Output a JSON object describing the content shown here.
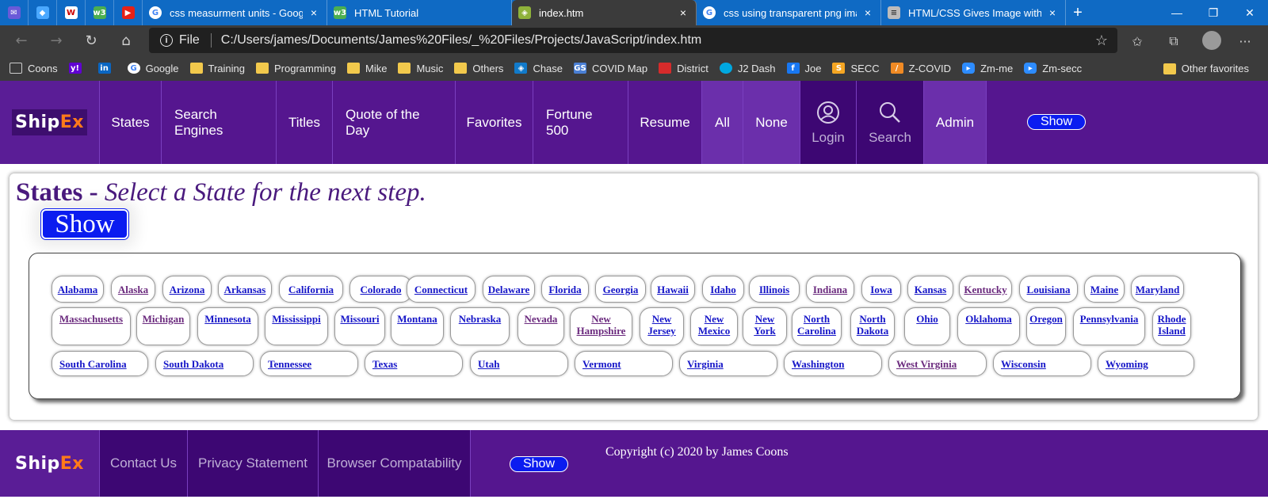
{
  "browser": {
    "tabs": [
      {
        "title": "css measurment units - Google"
      },
      {
        "title": "HTML Tutorial"
      },
      {
        "title": "index.htm"
      },
      {
        "title": "css using transparent png image"
      },
      {
        "title": "HTML/CSS Gives Image with Tra"
      }
    ],
    "close_glyph": "×",
    "new_tab_glyph": "+",
    "address": {
      "scheme_label": "File",
      "url": "C:/Users/james/Documents/James%20Files/_%20Files/Projects/JavaScript/index.htm"
    },
    "bookmarks": [
      {
        "label": "Coons",
        "icon": "page-icon"
      },
      {
        "label": "",
        "icon": "yahoo-icon"
      },
      {
        "label": "",
        "icon": "linkedin-icon"
      },
      {
        "label": "Google",
        "icon": "google-icon"
      },
      {
        "label": "Training",
        "icon": "folder-icon"
      },
      {
        "label": "Programming",
        "icon": "folder-icon"
      },
      {
        "label": "Mike",
        "icon": "folder-icon"
      },
      {
        "label": "Music",
        "icon": "folder-icon"
      },
      {
        "label": "Others",
        "icon": "folder-icon"
      },
      {
        "label": "Chase",
        "icon": "chase-icon"
      },
      {
        "label": "COVID Map",
        "icon": "map-icon"
      },
      {
        "label": "District",
        "icon": "district-icon"
      },
      {
        "label": "J2 Dash",
        "icon": "att-icon"
      },
      {
        "label": "Joe",
        "icon": "facebook-icon"
      },
      {
        "label": "SECC",
        "icon": "secc-icon"
      },
      {
        "label": "Z-COVID",
        "icon": "zcovid-icon"
      },
      {
        "label": "Zm-me",
        "icon": "zoom-icon"
      },
      {
        "label": "Zm-secc",
        "icon": "zoom-icon"
      }
    ],
    "other_favorites": "Other favorites"
  },
  "nav": {
    "logo_ship": "Ship",
    "logo_ex": "Ex",
    "items": [
      "States",
      "Search Engines",
      "Titles",
      "Quote of the Day",
      "Favorites",
      "Fortune 500",
      "Resume",
      "All",
      "None"
    ],
    "login": "Login",
    "search": "Search",
    "admin": "Admin",
    "show": "Show"
  },
  "main": {
    "heading_bold": "States -",
    "heading_italic": "Select a State for the next step.",
    "show_button": "Show",
    "states": [
      "Alabama",
      "Alaska",
      "Arizona",
      "Arkansas",
      "California",
      "Colorado",
      "Connecticut",
      "Delaware",
      "Florida",
      "Georgia",
      "Hawaii",
      "Idaho",
      "Illinois",
      "Indiana",
      "Iowa",
      "Kansas",
      "Kentucky",
      "Louisiana",
      "Maine",
      "Maryland",
      "Massachusetts",
      "Michigan",
      "Minnesota",
      "Mississippi",
      "Missouri",
      "Montana",
      "Nebraska",
      "Nevada",
      "New Hampshire",
      "New Jersey",
      "New Mexico",
      "New York",
      "North Carolina",
      "North Dakota",
      "Ohio",
      "Oklahoma",
      "Oregon",
      "Pennsylvania",
      "Rhode Island",
      "South Carolina",
      "South Dakota",
      "Tennessee",
      "Texas",
      "Utah",
      "Vermont",
      "Virginia",
      "Washington",
      "West Virginia",
      "Wisconsin",
      "Wyoming"
    ],
    "visited": [
      "Alaska",
      "Indiana",
      "Kentucky",
      "Massachusetts",
      "Michigan",
      "Nevada",
      "New Hampshire",
      "West Virginia"
    ]
  },
  "footer": {
    "logo_ship": "Ship",
    "logo_ex": "Ex",
    "links": [
      "Contact Us",
      "Privacy Statement",
      "Browser Compatability"
    ],
    "show": "Show",
    "copyright": "Copyright (c) 2020 by James Coons"
  },
  "colors": {
    "nav_bg": "#55168f",
    "accent_orange": "#ff7a1a",
    "show_blue": "#0b1cf0",
    "heading_purple": "#4a1a7e",
    "link_blue": "#1616c8",
    "link_visited": "#6b2a7e"
  }
}
